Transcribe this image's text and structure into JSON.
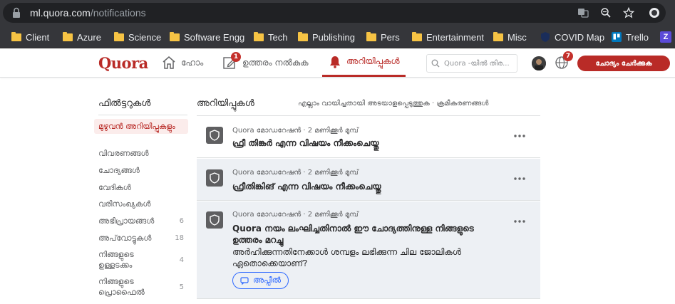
{
  "browser": {
    "url_host": "ml.quora.com",
    "url_path": "/notifications",
    "bookmarks": [
      {
        "label": "Client",
        "icon": "folder-icon"
      },
      {
        "label": "Azure",
        "icon": "folder-icon"
      },
      {
        "label": "Science",
        "icon": "folder-icon"
      },
      {
        "label": "Software Engg",
        "icon": "folder-icon"
      },
      {
        "label": "Tech",
        "icon": "folder-icon"
      },
      {
        "label": "Publishing",
        "icon": "folder-icon"
      },
      {
        "label": "Pers",
        "icon": "folder-icon"
      },
      {
        "label": "Entertainment",
        "icon": "folder-icon"
      },
      {
        "label": "Misc",
        "icon": "folder-icon"
      },
      {
        "label": "COVID Map",
        "icon": "shield-icon"
      },
      {
        "label": "Trello",
        "icon": "trello-icon"
      }
    ]
  },
  "header": {
    "logo": "Quora",
    "nav": {
      "home": "ഹോം",
      "answer": "ഉത്തരം നൽകുക",
      "notifications": "അറിയിപ്പുകൾ"
    },
    "answer_badge": "1",
    "search_placeholder": "Quora -യിൽ തിര...",
    "globe_badge": "7",
    "ask_button": "ചോദ്യം ചേർക്കുക",
    "accent_color": "#b92b27"
  },
  "filters": {
    "title": "ഫിൽട്ടറുകൾ",
    "items": [
      {
        "label": "മുഴുവൻ അറിയിപ്പുകളും",
        "count": ""
      },
      {
        "label": "വിവരണങ്ങൾ",
        "count": ""
      },
      {
        "label": "ചോദ്യങ്ങൾ",
        "count": ""
      },
      {
        "label": "വേദികൾ",
        "count": ""
      },
      {
        "label": "വരിസംഖ്യകൾ",
        "count": ""
      },
      {
        "label": "അഭിപ്രായങ്ങൾ",
        "count": "6"
      },
      {
        "label": "അപ്‌വോട്ടുകൾ",
        "count": "18"
      },
      {
        "label": "നിങ്ങളുടെ ഉള്ളടക്കം",
        "count": "4"
      },
      {
        "label": "നിങ്ങളുടെ പ്രൊഫൈൽ",
        "count": "5"
      }
    ]
  },
  "main": {
    "title": "അറിയിപ്പുകൾ",
    "actions": "എല്ലാം വായിച്ചതായി അടയാളപ്പെടുത്തുക · ക്രമീകരണങ്ങൾ",
    "notifications": [
      {
        "meta": "Quora മോഡറേഷൻ · 2 മണിക്കൂർ മുമ്പ്",
        "text": "ഫ്രീ തിങ്കർ എന്ന വിഷയം നീക്കംചെയ്തു",
        "sub": ""
      },
      {
        "meta": "Quora മോഡറേഷൻ · 2 മണിക്കൂർ മുമ്പ്",
        "text": "ഫ്രീതിങ്കിങ് എന്ന വിഷയം നീക്കംചെയ്തു",
        "sub": ""
      },
      {
        "meta": "Quora മോഡറേഷൻ · 2 മണിക്കൂർ മുമ്പ്",
        "text": "Quora നയം ലംഘിച്ചതിനാൽ ഈ ചോദ്യത്തിനുള്ള നിങ്ങളുടെ ഉത്തരം മറച്ചു",
        "sub": "അർഹിക്കുന്നതിനേക്കാൾ ശമ്പളം ലഭിക്കുന്ന ചില ജോലികൾ ഏതൊക്കെയാണ്?",
        "appeal": "അപ്പീൽ"
      }
    ]
  }
}
